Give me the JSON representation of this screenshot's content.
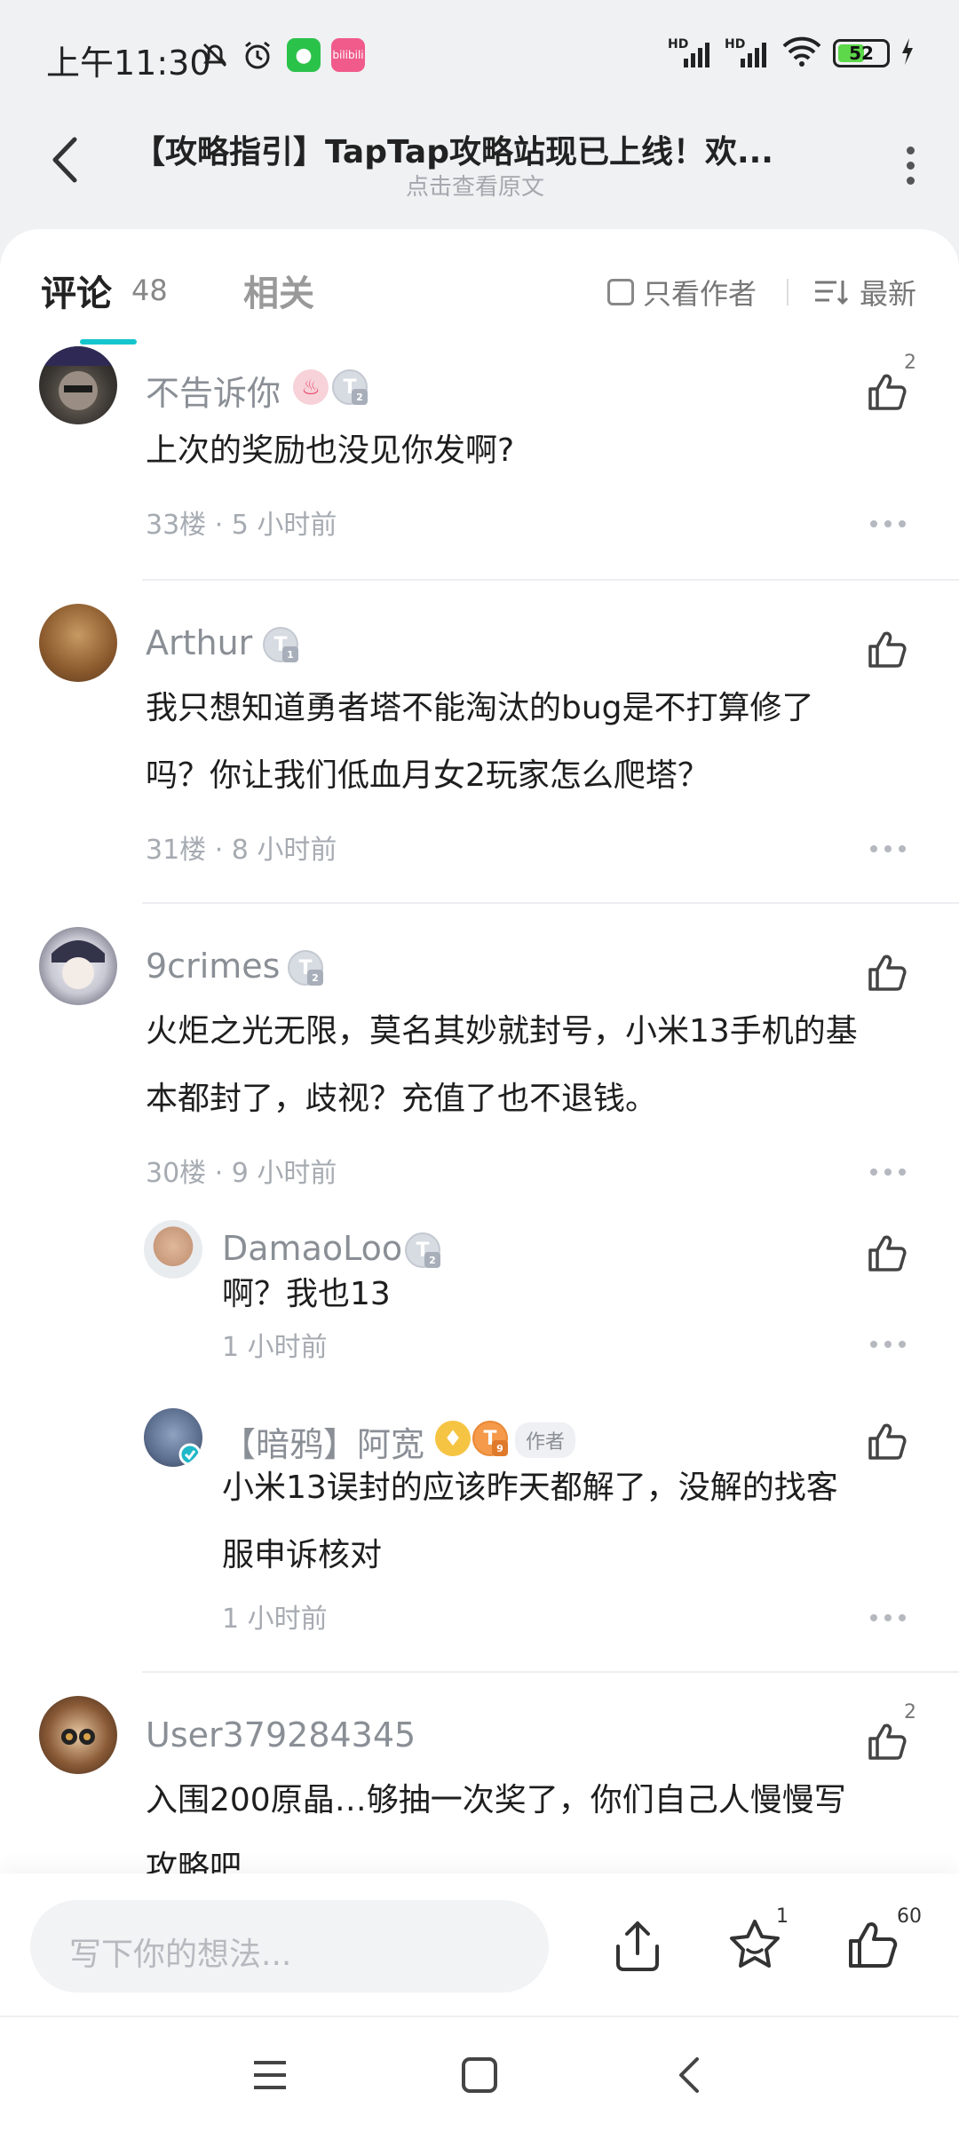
{
  "status": {
    "time": "上午11:30",
    "battery": "52",
    "signal_label_1": "HD",
    "signal_label_2": "HD",
    "bili_label": "bilibili"
  },
  "header": {
    "title": "【攻略指引】TapTap攻略站现已上线！欢...",
    "subtitle": "点击查看原文"
  },
  "tabs": {
    "comments_label": "评论",
    "comments_count": "48",
    "related_label": "相关",
    "author_only_label": "只看作者",
    "sort_label": "最新"
  },
  "comments": [
    {
      "username": "不告诉你",
      "badge": "T",
      "badge_level": "2",
      "content": "上次的奖励也没见你发啊?",
      "meta": "33楼 · 5 小时前",
      "likes": "2"
    },
    {
      "username": "Arthur",
      "badge": "T",
      "badge_level": "1",
      "content_line1": "我只想知道勇者塔不能淘汰的bug是不打算修了",
      "content_line2": "吗？你让我们低血月女2玩家怎么爬塔？",
      "meta": "31楼 · 8 小时前"
    },
    {
      "username": "9crimes",
      "badge": "T",
      "badge_level": "2",
      "content_line1": "火炬之光无限，莫名其妙就封号，小米13手机的基",
      "content_line2": "本都封了，歧视？充值了也不退钱。",
      "meta": "30楼 · 9 小时前",
      "replies": [
        {
          "username": "DamaoLoo",
          "badge": "T",
          "badge_level": "2",
          "content": "啊？我也13",
          "meta": "1 小时前"
        },
        {
          "username": "【暗鸦】阿宽",
          "badge": "T",
          "badge_level": "9",
          "author_tag": "作者",
          "content_line1": "小米13误封的应该昨天都解了，没解的找客",
          "content_line2": "服申诉核对",
          "meta": "1 小时前"
        }
      ]
    },
    {
      "username": "User379284345",
      "content_line1": "入围200原晶…够抽一次奖了，你们自己人慢慢写",
      "content_line2": "攻略吧",
      "likes": "2"
    }
  ],
  "bottom_bar": {
    "input_placeholder": "写下你的想法...",
    "star_count": "1",
    "like_count": "60"
  },
  "colors": {
    "accent": "#15c5ce",
    "muted_text": "#a6abb2"
  }
}
